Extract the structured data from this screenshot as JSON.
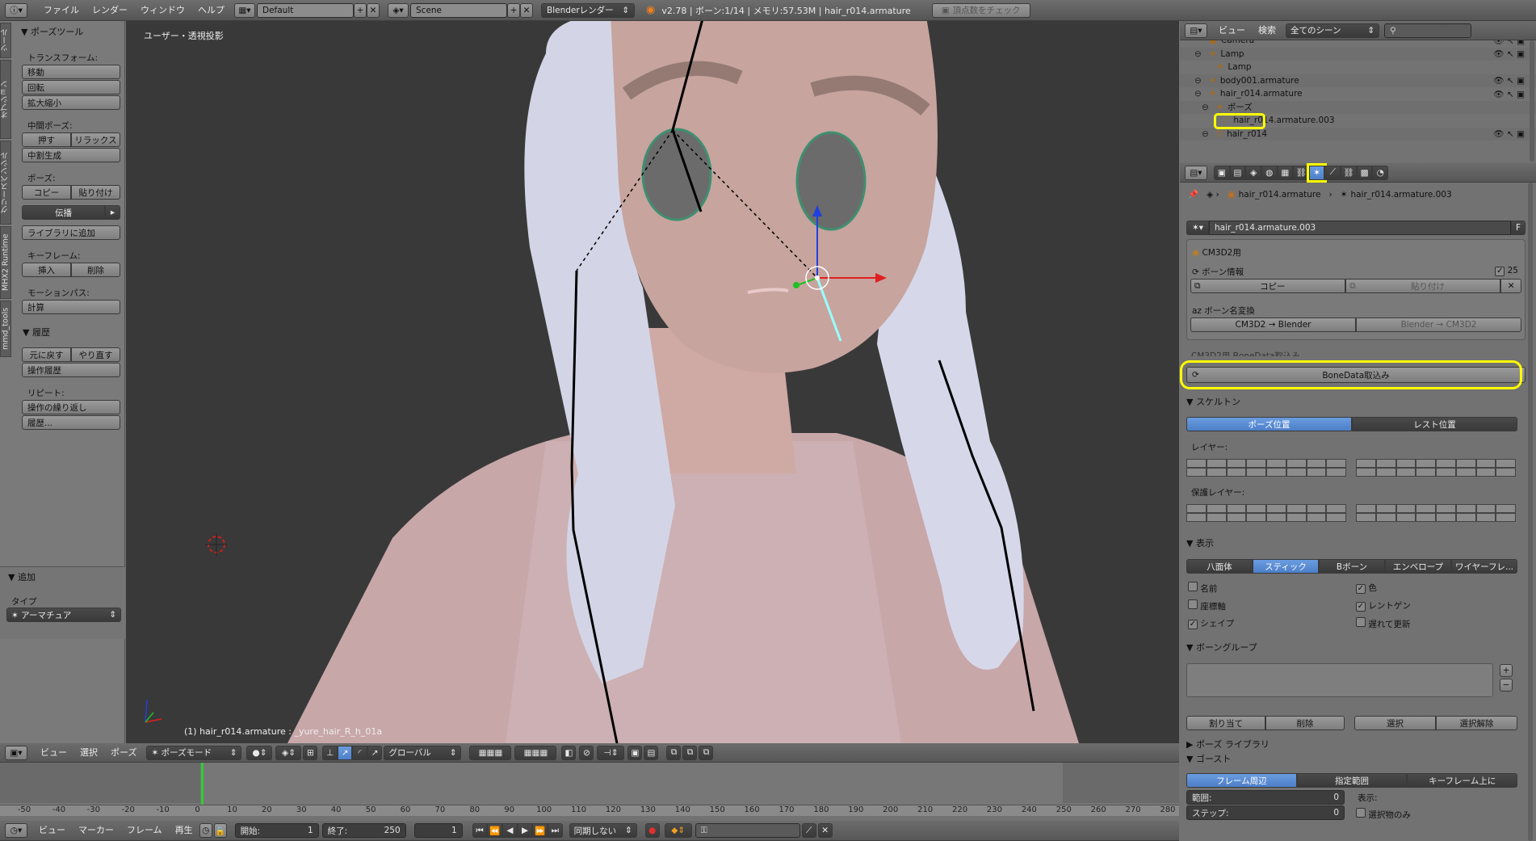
{
  "topbar": {
    "menus": [
      "ファイル",
      "レンダー",
      "ウィンドウ",
      "ヘルプ"
    ],
    "screen_layout": "Default",
    "scene": "Scene",
    "render_engine": "Blenderレンダー",
    "info": "v2.78 | ボーン:1/14 | メモリ:57.53M | hair_r014.armature",
    "vertex_check_button": "頂点数をチェック"
  },
  "toolshelf": {
    "vertical_tabs": [
      "ツール",
      "オプション",
      "グリースペンシル",
      "MHX2 Runtime",
      "mmd_tools"
    ],
    "panel_title": "ポーズツール",
    "transform_label": "トランスフォーム:",
    "move": "移動",
    "rotate": "回転",
    "scale": "拡大縮小",
    "inbetween_label": "中間ポーズ:",
    "push": "押す",
    "relax": "リラックス",
    "breakdowner": "中割生成",
    "pose_label": "ポーズ:",
    "copy": "コピー",
    "paste": "貼り付け",
    "propagate": "伝播",
    "add_to_library": "ライブラリに追加",
    "keyframe_label": "キーフレーム:",
    "insert": "挿入",
    "delete": "削除",
    "motion_path_label": "モーションパス:",
    "calculate": "計算",
    "history_title": "履歴",
    "undo": "元に戻す",
    "redo": "やり直す",
    "undo_history": "操作履歴",
    "repeat_label": "リピート:",
    "repeat_last": "操作の繰り返し",
    "repeat_history": "履歴...",
    "add_title": "追加",
    "type_label": "タイプ",
    "type_value": "アーマチュア"
  },
  "viewport": {
    "view_label": "ユーザー・透視投影",
    "status": "(1) hair_r014.armature : _yure_hair_R_h_01a"
  },
  "viewport_header": {
    "menus": [
      "ビュー",
      "選択",
      "ポーズ"
    ],
    "mode": "ポーズモード",
    "orientation": "グローバル"
  },
  "outliner": {
    "menus": [
      "ビュー",
      "検索"
    ],
    "filter": "全てのシーン",
    "rows": [
      {
        "label": "Camera",
        "indent": 2
      },
      {
        "label": "Lamp",
        "indent": 2
      },
      {
        "label": "Lamp",
        "indent": 3
      },
      {
        "label": "body001.armature",
        "indent": 2
      },
      {
        "label": "hair_r014.armature",
        "indent": 2
      },
      {
        "label": "ポーズ",
        "indent": 3
      },
      {
        "label": "hair_r014.armature.003",
        "indent": 4
      },
      {
        "label": "hair_r014",
        "indent": 3
      }
    ]
  },
  "properties": {
    "breadcrumb": [
      "hair_r014.armature",
      "hair_r014.armature.003"
    ],
    "bone_name": "hair_r014.armature.003",
    "fake_user": "F",
    "cm3d2_label": "CM3D2用",
    "bone_info_label": "ボーン情報",
    "bone_info_count": "25",
    "copy": "コピー",
    "paste": "貼り付け",
    "rename_label": "ボーン名変換",
    "cm3d2_to_blender": "CM3D2 → Blender",
    "blender_to_cm3d2": "Blender → CM3D2",
    "hidden_label": "CM3D2用 BoneData取込み",
    "bonedata_import": "BoneData取込み",
    "skeleton_title": "スケルトン",
    "pose_position": "ポーズ位置",
    "rest_position": "レスト位置",
    "layers_label": "レイヤー:",
    "protected_layers_label": "保護レイヤー:",
    "display_title": "表示",
    "display_modes": [
      "八面体",
      "スティック",
      "Bボーン",
      "エンベロープ",
      "ワイヤーフレ..."
    ],
    "names": "名前",
    "axes": "座標軸",
    "shapes": "シェイプ",
    "colors": "色",
    "xray": "レントゲン",
    "delay_refresh": "遅れて更新",
    "bone_groups_title": "ボーングループ",
    "assign": "割り当て",
    "remove": "削除",
    "select": "選択",
    "deselect": "選択解除",
    "pose_library_title": "ポーズ ライブラリ",
    "ghost_title": "ゴースト",
    "ghost_modes": [
      "フレーム周辺",
      "指定範囲",
      "キーフレーム上に"
    ],
    "range_label": "範囲:",
    "range_value": "0",
    "step_label": "ステップ:",
    "step_value": "0",
    "display_label": "表示:",
    "selected_only": "選択物のみ"
  },
  "timeline": {
    "ticks": [
      "-50",
      "-40",
      "-30",
      "-20",
      "-10",
      "0",
      "10",
      "20",
      "30",
      "40",
      "50",
      "60",
      "70",
      "80",
      "90",
      "100",
      "110",
      "120",
      "130",
      "140",
      "150",
      "160",
      "170",
      "180",
      "190",
      "200",
      "210",
      "220",
      "230",
      "240",
      "250",
      "260",
      "270",
      "280"
    ],
    "current_frame_marker": "0",
    "menus": [
      "ビュー",
      "マーカー",
      "フレーム",
      "再生"
    ],
    "start_label": "開始:",
    "start_value": "1",
    "end_label": "終了:",
    "end_value": "250",
    "current_value": "1",
    "sync": "同期しない"
  },
  "colors": {
    "highlight": "#ffff00",
    "accent_blue": "#5680c2",
    "x_axis": "#e02020",
    "y_axis": "#20c020",
    "z_axis": "#2040e0"
  }
}
